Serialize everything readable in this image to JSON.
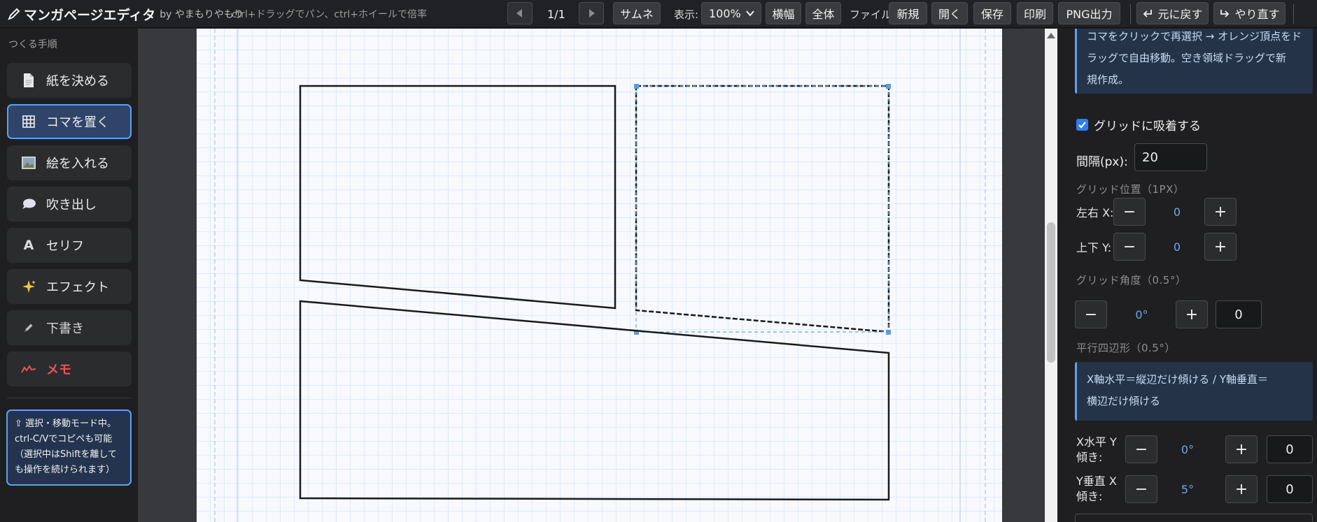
{
  "toolbar": {
    "app_title": "マンガページエディタ",
    "app_by": "by やまもりやもり",
    "hint": "ctrl+ドラッグでパン、ctrl+ホイールで倍率",
    "page_indicator": "1/1",
    "thumbs_label": "サムネ",
    "view_label": "表示:",
    "zoom_value": "100%",
    "fit_width_label": "横幅",
    "fit_all_label": "全体",
    "file_label": "ファイル:",
    "new_label": "新規",
    "open_label": "開く",
    "save_label": "保存",
    "print_label": "印刷",
    "png_label": "PNG出力",
    "undo_label": "元に戻す",
    "redo_label": "やり直す"
  },
  "sidebar": {
    "heading": "つくる手順",
    "steps": [
      {
        "label": "紙を決める",
        "icon": "paper-icon"
      },
      {
        "label": "コマを置く",
        "icon": "grid-icon",
        "active": true
      },
      {
        "label": "絵を入れる",
        "icon": "picture-icon"
      },
      {
        "label": "吹き出し",
        "icon": "speech-bubble-icon"
      },
      {
        "label": "セリフ",
        "icon": "text-icon"
      },
      {
        "label": "エフェクト",
        "icon": "sparkle-icon"
      },
      {
        "label": "下書き",
        "icon": "pencil-icon"
      },
      {
        "label": "メモ",
        "icon": "memo-scribble-icon"
      }
    ],
    "notice_lines": [
      "⇧ 選択・移動モード中。",
      "ctrl-C/Vでコピペも可能",
      "（選択中はShiftを離して",
      "も操作を続けられます）"
    ]
  },
  "panel": {
    "info_top_lines": [
      "コマをクリックで再選択 → オレンジ頂点をド",
      "ラッグで自由移動。空き領域ドラッグで新",
      "規作成。"
    ],
    "snap_label": "グリッドに吸着する",
    "interval_label": "間隔(px):",
    "interval_value": "20",
    "grid_pos_heading": "グリッド位置（1PX）",
    "lr_label": "左右 X:",
    "lr_value": "0",
    "ud_label": "上下 Y:",
    "ud_value": "0",
    "grid_angle_heading": "グリッド角度（0.5°）",
    "grid_angle_value": "0°",
    "grid_angle_input": "0",
    "para_heading": "平行四辺形（0.5°）",
    "para_info_lines": [
      "X軸水平＝縦辺だけ傾ける / Y軸垂直＝",
      "横辺だけ傾ける"
    ],
    "xh_label_1": "X水平 Y",
    "xh_label_2": "傾き:",
    "xh_value": "0°",
    "xh_input": "0",
    "yv_label_1": "Y垂直 X",
    "yv_label_2": "傾き:",
    "yv_value": "5°",
    "yv_input": "0",
    "minus_symbol": "−",
    "plus_symbol": "+"
  },
  "colors": {
    "accent": "#5ea2ee",
    "memo": "#e8545a",
    "grid_line": "#c9daf2",
    "panel_border": "#1a1a1a",
    "selection": "#3b6fb5"
  }
}
